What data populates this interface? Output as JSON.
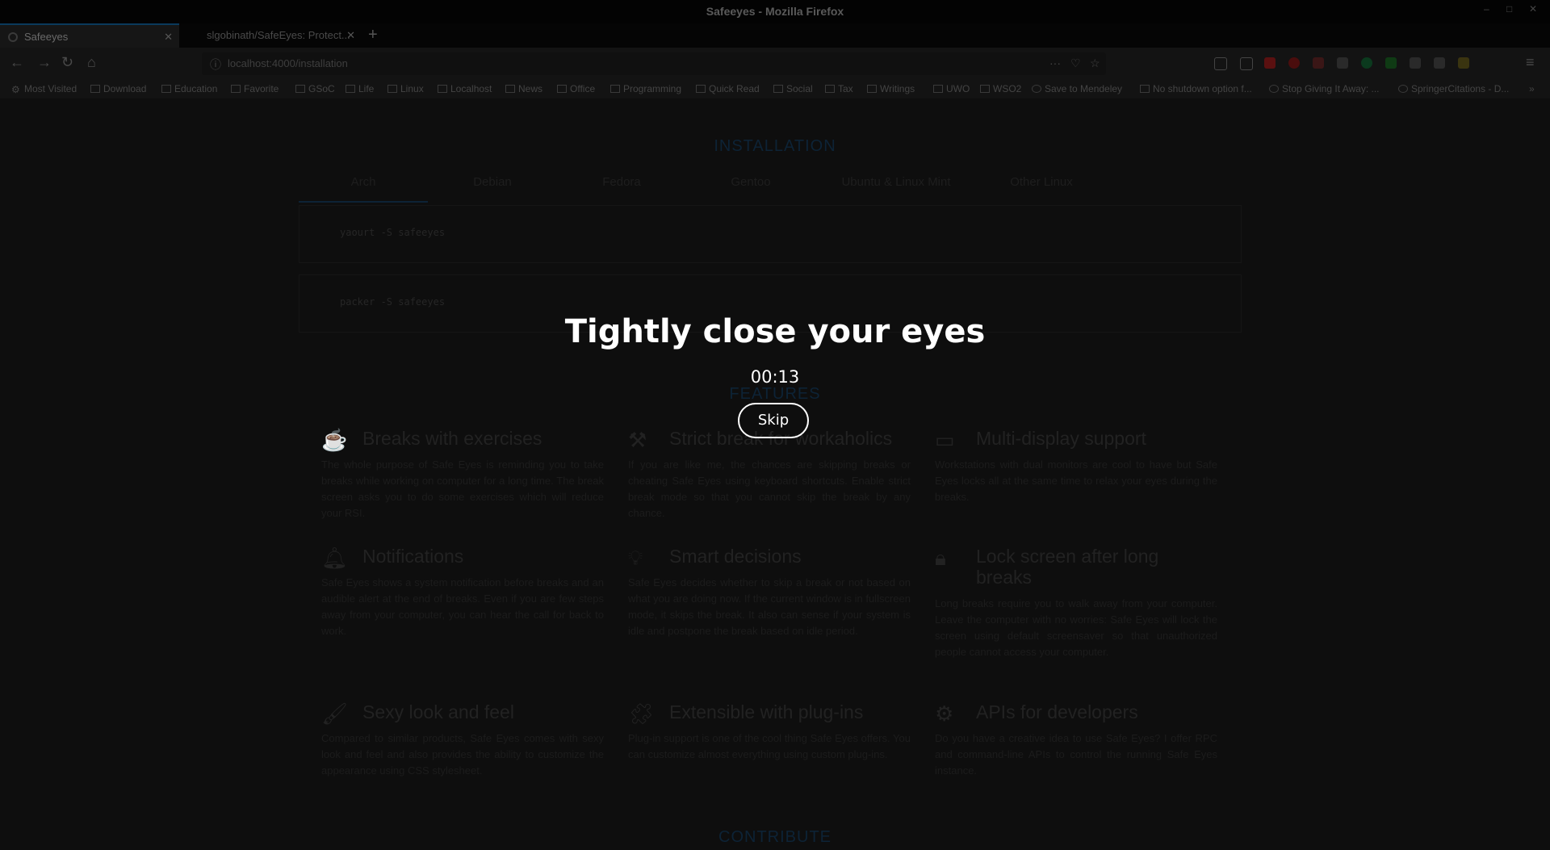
{
  "window": {
    "title": "Safeeyes - Mozilla Firefox"
  },
  "tabs": [
    {
      "label": "Safeeyes"
    },
    {
      "label": "slgobinath/SafeEyes: Protect..."
    }
  ],
  "navbar": {
    "url": "localhost:4000/installation"
  },
  "bookmarks": [
    "Most Visited",
    "Download",
    "Education",
    "Favorite",
    "GSoC",
    "Life",
    "Linux",
    "Localhost",
    "News",
    "Office",
    "Programming",
    "Quick Read",
    "Social",
    "Tax",
    "Writings",
    "UWO",
    "WSO2",
    "Save to Mendeley",
    "No shutdown option f...",
    "Stop Giving It Away: ...",
    "SpringerCitations - D..."
  ],
  "installation": {
    "heading": "INSTALLATION",
    "tabs": [
      "Arch",
      "Debian",
      "Fedora",
      "Gentoo",
      "Ubuntu & Linux Mint",
      "Other Linux"
    ],
    "commands": [
      "yaourt -S safeeyes",
      "packer -S safeeyes"
    ]
  },
  "features": {
    "heading": "FEATURES",
    "items": [
      {
        "icon": "coffee-cup-icon",
        "title": "Breaks with exercises",
        "desc": "The whole purpose of Safe Eyes is reminding you to take breaks while working on computer for a long time. The break screen asks you to do some exercises which will reduce your RSI."
      },
      {
        "icon": "gavel-icon",
        "title": "Strict break for workaholics",
        "desc": "If you are like me, the chances are skipping breaks or cheating Safe Eyes using keyboard shortcuts. Enable strict break mode so that you cannot skip the break by any chance."
      },
      {
        "icon": "monitor-icon",
        "title": "Multi-display support",
        "desc": "Workstations with dual monitors are cool to have but Safe Eyes locks all at the same time to relax your eyes during the breaks."
      },
      {
        "icon": "bell-icon",
        "title": "Notifications",
        "desc": "Safe Eyes shows a system notification before breaks and an audible alert at the end of breaks. Even if you are few steps away from your computer, you can hear the call for back to work."
      },
      {
        "icon": "lightbulb-icon",
        "title": "Smart decisions",
        "desc": "Safe Eyes decides whether to skip a break or not based on what you are doing now. If the current window is in fullscreen mode, it skips the break. It also can sense if your system is idle and postpone the break based on idle period."
      },
      {
        "icon": "lock-icon",
        "title": "Lock screen after long breaks",
        "desc": "Long breaks require you to walk away from your computer. Leave the computer with no worries: Safe Eyes will lock the screen using default screensaver so that unauthorized people cannot access your computer."
      },
      {
        "icon": "paintbrush-icon",
        "title": "Sexy look and feel",
        "desc": "Compared to similar products, Safe Eyes comes with sexy look and feel and also provides the ability to customize the appearance using CSS stylesheet."
      },
      {
        "icon": "puzzle-icon",
        "title": "Extensible with plug-ins",
        "desc": "Plug-in support is one of the cool thing Safe Eyes offers. You can customize almost everything using custom plug-ins."
      },
      {
        "icon": "gears-icon",
        "title": "APIs for developers",
        "desc": "Do you have a creative idea to use Safe Eyes? I offer RPC and command-line APIs to control the running Safe Eyes instance."
      }
    ]
  },
  "contribute": {
    "heading": "CONTRIBUTE"
  },
  "break_overlay": {
    "title": "Tightly close your eyes",
    "countdown": "00:13",
    "skip_label": "Skip"
  }
}
